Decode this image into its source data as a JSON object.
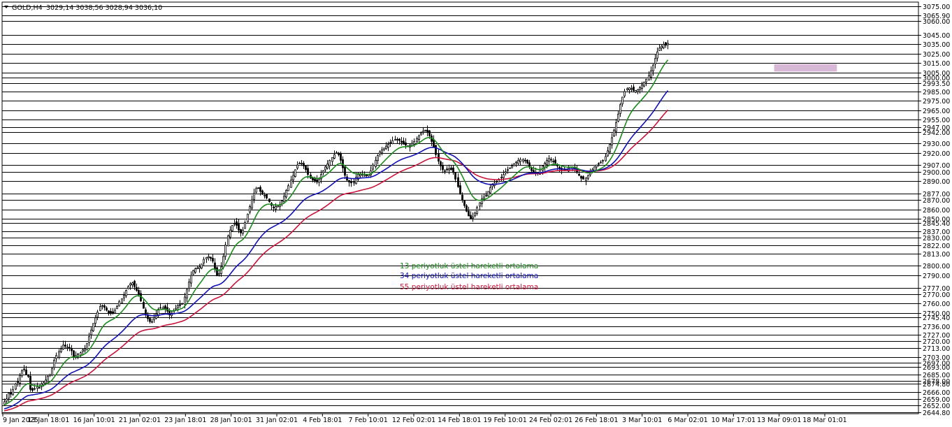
{
  "header": {
    "symbol": "GOLD,H4",
    "ohlc": "3029,14 3038,56 3028,94 3036,10"
  },
  "colors": {
    "ema13": "#1e8a1e",
    "ema34": "#1010b4",
    "ema55": "#c8143c",
    "zone": "#d7b9d7",
    "candle": "#000000",
    "grid": "#000000"
  },
  "legend": {
    "ema13": "13 periyotluk üstel hareketli ortalama",
    "ema34": "34 periyotluk üstel hareketli ortalama",
    "ema55": "55 periyotluk üstel hareketli ortalama"
  },
  "chart_data": {
    "type": "line",
    "title": "GOLD,H4",
    "y_ticks": [
      3075.0,
      3065.9,
      3060.0,
      3045.0,
      3035.0,
      3025.0,
      3015.0,
      3005.0,
      3000.0,
      2993.5,
      2985.0,
      2975.0,
      2965.0,
      2955.0,
      2947.0,
      2942.0,
      2930.0,
      2920.0,
      2907.0,
      2900.0,
      2890.0,
      2877.0,
      2870.0,
      2860.0,
      2850.0,
      2845.4,
      2837.0,
      2830.0,
      2822.0,
      2813.0,
      2800.0,
      2790.0,
      2777.0,
      2770.0,
      2760.0,
      2750.0,
      2745.4,
      2736.0,
      2727.0,
      2720.0,
      2713.0,
      2703.0,
      2697.0,
      2693.0,
      2685.0,
      2678.0,
      2674.8,
      2666.0,
      2659.0,
      2652.0,
      2644.8
    ],
    "y_tick_labels": [
      "3075.00",
      "3065.90",
      "3060.00",
      "3045.00",
      "3035.00",
      "3025.00",
      "3015.00",
      "3005.00",
      "3000.00",
      "2993.50",
      "2985.00",
      "2975.00",
      "2965.00",
      "2955.00",
      "2947.00",
      "2942.00",
      "2930.00",
      "2920.00",
      "2907.00",
      "2900.00",
      "2890.00",
      "2877.00",
      "2870.00",
      "2860.00",
      "2850.00",
      "2845.40",
      "2837.00",
      "2830.00",
      "2822.00",
      "2813.00",
      "2800.00",
      "2790.00",
      "2777.00",
      "2770.00",
      "2760.00",
      "2750.00",
      "2745.40",
      "2736.00",
      "2727.00",
      "2720.00",
      "2713.00",
      "2703.00",
      "2697.00",
      "2693.00",
      "2685.00",
      "2678.00",
      "2674.80",
      "2666.00",
      "2659.00",
      "2652.00",
      "2644.80"
    ],
    "ylim": [
      2644,
      3079
    ],
    "x_labels": [
      "9 Jan 2025",
      "13 Jan 18:01",
      "16 Jan 10:01",
      "21 Jan 02:01",
      "23 Jan 18:01",
      "28 Jan 10:01",
      "31 Jan 02:01",
      "4 Feb 18:01",
      "7 Feb 10:01",
      "12 Feb 02:01",
      "14 Feb 18:01",
      "19 Feb 10:01",
      "24 Feb 02:01",
      "26 Feb 18:01",
      "3 Mar 10:01",
      "6 Mar 02:01",
      "10 Mar 17:01",
      "13 Mar 09:01",
      "18 Mar 01:01"
    ],
    "bar_count": 380,
    "close": [
      2656,
      2659,
      2665,
      2664,
      2669,
      2675,
      2677,
      2684,
      2689,
      2690,
      2685,
      2683,
      2669,
      2668,
      2670,
      2672,
      2671,
      2675,
      2676,
      2679,
      2683,
      2685,
      2691,
      2700,
      2705,
      2709,
      2712,
      2716,
      2715,
      2714,
      2713,
      2710,
      2703,
      2705,
      2707,
      2708,
      2711,
      2712,
      2718,
      2725,
      2732,
      2739,
      2745,
      2751,
      2757,
      2758,
      2756,
      2753,
      2750,
      2750,
      2750,
      2753,
      2757,
      2762,
      2765,
      2769,
      2774,
      2778,
      2781,
      2782,
      2778,
      2774,
      2770,
      2763,
      2755,
      2748,
      2744,
      2741,
      2741,
      2745,
      2749,
      2754,
      2755,
      2756,
      2755,
      2752,
      2748,
      2749,
      2752,
      2755,
      2758,
      2758,
      2760,
      2767,
      2775,
      2783,
      2790,
      2795,
      2797,
      2798,
      2799,
      2802,
      2807,
      2809,
      2810,
      2808,
      2805,
      2797,
      2790,
      2792,
      2799,
      2810,
      2822,
      2832,
      2838,
      2843,
      2845,
      2843,
      2838,
      2835,
      2838,
      2846,
      2855,
      2863,
      2870,
      2877,
      2882,
      2882,
      2879,
      2876,
      2875,
      2872,
      2868,
      2864,
      2862,
      2863,
      2864,
      2865,
      2869,
      2874,
      2880,
      2885,
      2891,
      2896,
      2902,
      2907,
      2909,
      2909,
      2906,
      2902,
      2897,
      2893,
      2891,
      2890,
      2889,
      2892,
      2897,
      2901,
      2905,
      2908,
      2912,
      2915,
      2918,
      2920,
      2918,
      2912,
      2904,
      2896,
      2891,
      2889,
      2888,
      2889,
      2894,
      2897,
      2897,
      2897,
      2896,
      2896,
      2897,
      2901,
      2907,
      2912,
      2917,
      2921,
      2923,
      2925,
      2927,
      2929,
      2931,
      2933,
      2934,
      2934,
      2933,
      2931,
      2929,
      2928,
      2927,
      2928,
      2930,
      2932,
      2935,
      2938,
      2941,
      2943,
      2944,
      2942,
      2938,
      2932,
      2926,
      2918,
      2911,
      2906,
      2902,
      2901,
      2902,
      2903,
      2902,
      2899,
      2892,
      2884,
      2876,
      2870,
      2864,
      2858,
      2853,
      2850,
      2852,
      2856,
      2862,
      2867,
      2871,
      2873,
      2875,
      2879,
      2883,
      2886,
      2888,
      2889,
      2892,
      2894,
      2897,
      2900,
      2902,
      2904,
      2906,
      2908,
      2910,
      2912,
      2913,
      2913,
      2912,
      2909,
      2905,
      2901,
      2899,
      2898,
      2899,
      2902,
      2906,
      2909,
      2912,
      2914,
      2913,
      2911,
      2909,
      2906,
      2903,
      2901,
      2901,
      2902,
      2904,
      2905,
      2905,
      2903,
      2899,
      2896,
      2893,
      2892,
      2893,
      2896,
      2899,
      2902,
      2905,
      2907,
      2908,
      2910,
      2912,
      2916,
      2922,
      2929,
      2936,
      2944,
      2952,
      2961,
      2971,
      2979,
      2985,
      2988,
      2989,
      2988,
      2986,
      2986,
      2987,
      2989,
      2992,
      2995,
      2998,
      3002,
      3007,
      3013,
      3020,
      3027,
      3031,
      3033,
      3035,
      3034,
      3036
    ]
  }
}
